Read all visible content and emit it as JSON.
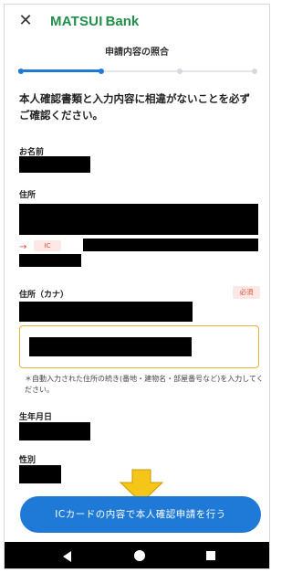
{
  "header": {
    "close_icon": "close-icon",
    "logo_matsui": "MATSUI",
    "logo_bank": "Bank",
    "step_title": "申請内容の照合"
  },
  "progress": {
    "total_steps": 4,
    "current_step": 2
  },
  "instructions": "本人確認書類と入力内容に相違がないことを必ずご確認ください。",
  "fields": {
    "name_label": "お名前",
    "address_label": "住所",
    "ic_marker": "→",
    "ic_badge": "IC",
    "address_kana_label": "住所（カナ）",
    "required_badge": "必須",
    "note": "＊自動入力された住所の続き(番地・建物名・部屋番号など)を入力してください。",
    "birthdate_label": "生年月日",
    "gender_label": "性別"
  },
  "cta": {
    "label": "ICカードの内容で本人確認申請を行う"
  },
  "colors": {
    "brand_green": "#1f8f4b",
    "primary_blue": "#1f79d6",
    "required_red": "#e0503c",
    "highlight_yellow": "#f5c518"
  },
  "navbar": {
    "back": "back-icon",
    "home": "home-icon",
    "recent": "recent-apps-icon"
  }
}
